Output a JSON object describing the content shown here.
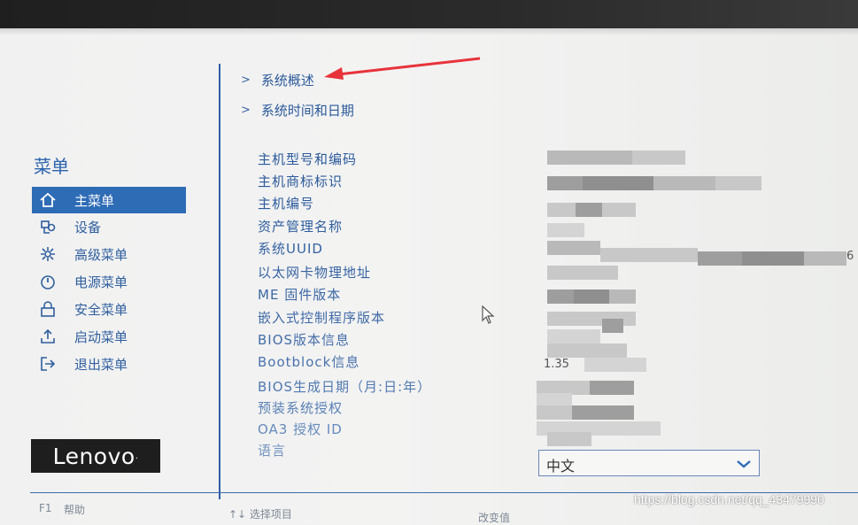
{
  "sidebar": {
    "title": "菜单",
    "items": [
      {
        "label": "主菜单",
        "icon": "home-icon"
      },
      {
        "label": "设备",
        "icon": "devices-icon"
      },
      {
        "label": "高级菜单",
        "icon": "advanced-gear-icon"
      },
      {
        "label": "电源菜单",
        "icon": "power-icon"
      },
      {
        "label": "安全菜单",
        "icon": "lock-icon"
      },
      {
        "label": "启动菜单",
        "icon": "boot-icon"
      },
      {
        "label": "退出菜单",
        "icon": "exit-icon"
      }
    ],
    "active_index": 0
  },
  "brand": {
    "logo_text": "Lenovo",
    "logo_mark": "."
  },
  "sections": [
    {
      "label": "系统概述"
    },
    {
      "label": "系统时间和日期"
    }
  ],
  "info": {
    "labels": [
      {
        "text": "主机型号和编码"
      },
      {
        "text": "主机商标标识"
      },
      {
        "text": "主机编号"
      },
      {
        "text": "资产管理名称"
      },
      {
        "text": "系统UUID"
      },
      {
        "text": "以太网卡物理地址"
      },
      {
        "text": "ME 固件版本"
      },
      {
        "text": "嵌入式控制程序版本"
      },
      {
        "text": "BIOS版本信息"
      },
      {
        "text": "Bootblock信息"
      },
      {
        "text": "BIOS生成日期（月:日:年）"
      },
      {
        "text": "预装系统授权"
      },
      {
        "text": "OA3 授权 ID"
      },
      {
        "text": "语言"
      }
    ],
    "partial_values": {
      "mac_suffix": "6",
      "bootblock_prefix": "1.35"
    }
  },
  "language_select": {
    "value": "中文"
  },
  "footer": {
    "f1_key": "F1",
    "f1_label": "帮助",
    "nav_label": "↑↓  选择项目",
    "right_partial": "改变值"
  },
  "watermark": "https://blog.csdn.net/qq_43479990",
  "colors": {
    "accent": "#2e6cb6",
    "text_blue": "#2b5a9b",
    "annotation_arrow": "#e8333a"
  }
}
